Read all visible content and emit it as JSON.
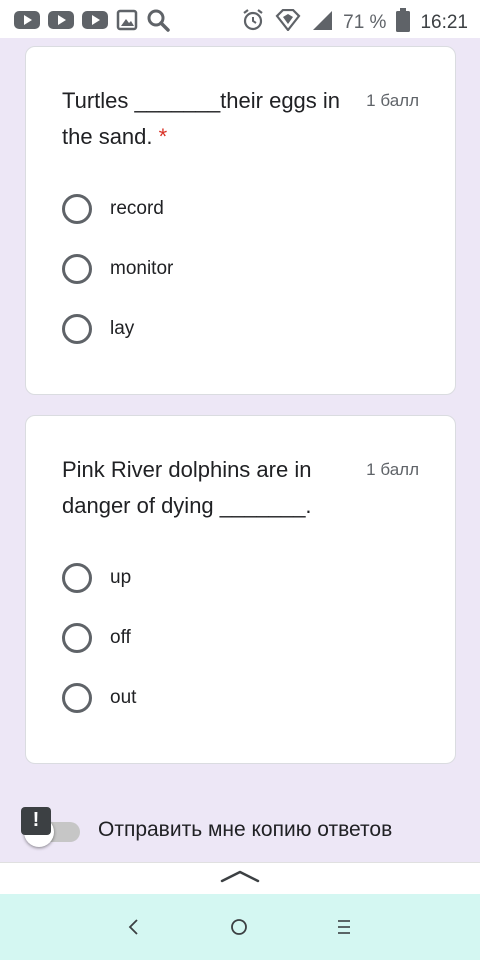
{
  "status_bar": {
    "icons": [
      "youtube-icon",
      "youtube-icon",
      "youtube-icon",
      "image-icon",
      "search-icon",
      "alarm-icon",
      "data-saver-icon",
      "signal-icon",
      "battery-icon"
    ],
    "battery": "71 %",
    "time": "16:21"
  },
  "questions": [
    {
      "text": "Turtles _______their eggs in the sand.",
      "required_mark": "*",
      "points": "1 балл",
      "options": [
        "record",
        "monitor",
        "lay"
      ]
    },
    {
      "text": "Pink River dolphins are in danger of dying _______.",
      "points": "1 балл",
      "options": [
        "up",
        "off",
        "out"
      ]
    }
  ],
  "copy_responses": {
    "label": "Отправить мне копию ответов",
    "enabled": false,
    "feedback_icon": "!"
  },
  "nav": {
    "icons": [
      "back-icon",
      "home-icon",
      "recents-icon"
    ]
  },
  "colors": {
    "background": "#ede7f6",
    "required": "#d93025",
    "nav_bar": "#d4f7f2"
  }
}
